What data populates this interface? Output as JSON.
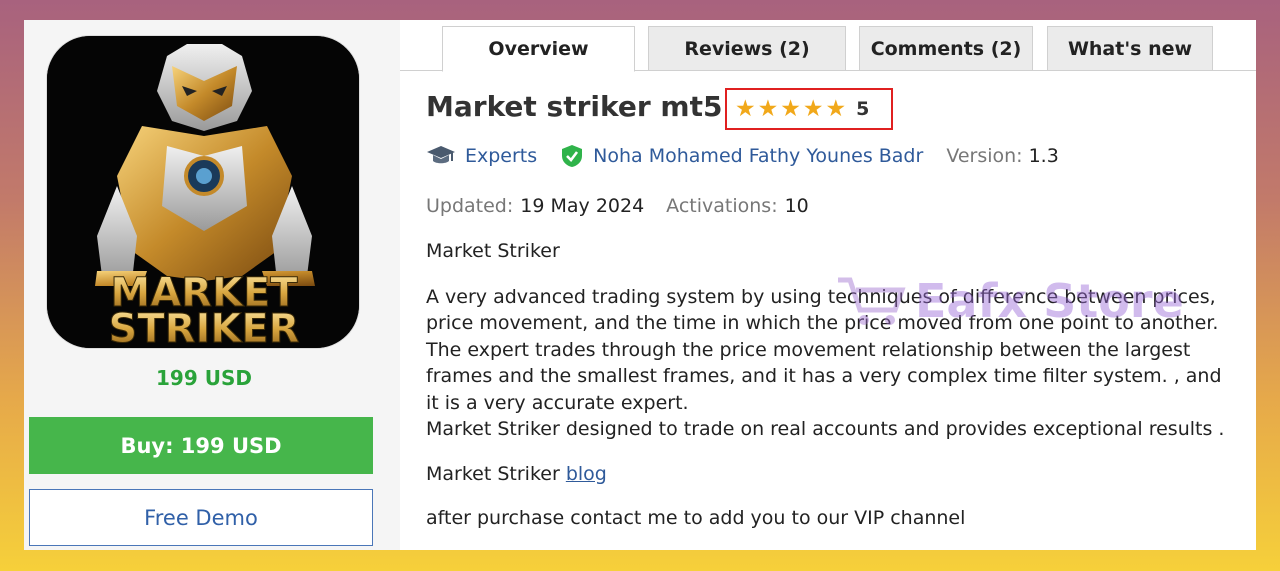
{
  "product": {
    "logo_text_line1": "MARKET",
    "logo_text_line2": "STRIKER",
    "price": "199 USD",
    "buy_label": "Buy: 199 USD",
    "demo_label": "Free Demo"
  },
  "tabs": [
    {
      "label": "Overview",
      "active": true
    },
    {
      "label": "Reviews (2)",
      "active": false
    },
    {
      "label": "Comments (2)",
      "active": false
    },
    {
      "label": "What's new",
      "active": false
    }
  ],
  "header": {
    "title": "Market striker mt5",
    "rating_value": "5",
    "stars": 5,
    "star_color": "#f1a81a"
  },
  "meta": {
    "category": "Experts",
    "author": "Noha Mohamed Fathy Younes Badr",
    "version_label": "Version:",
    "version_value": "1.3",
    "updated_label": "Updated:",
    "updated_value": "19 May 2024",
    "activations_label": "Activations:",
    "activations_value": "10"
  },
  "description": {
    "heading": "Market Striker",
    "paragraph_lines": [
      "A very advanced trading system by using techniques of difference between prices,",
      "price movement, and the time in which the price moved from one point to another.",
      "The expert trades through the price movement relationship between the largest",
      "frames and the smallest frames, and it has a very complex time filter system. , and",
      "it is a very accurate expert.",
      "Market Striker designed to trade on real accounts and provides exceptional results ."
    ],
    "blog_prefix": "Market Striker",
    "blog_link": "blog",
    "footer": "after purchase contact me to add you to our VIP channel"
  },
  "watermark": {
    "text": "Eafx Store"
  },
  "colors": {
    "buy_green": "#46b64b",
    "price_green": "#2aa33a",
    "link_blue": "#2f5a9a",
    "verified_green": "#2fb34a",
    "highlight_red": "#e02020"
  }
}
